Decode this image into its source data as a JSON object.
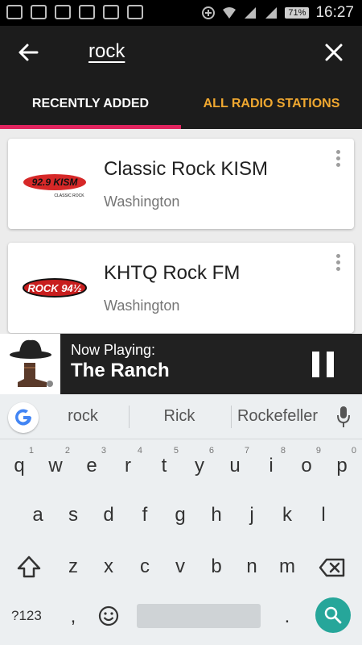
{
  "status_bar": {
    "time": "16:27",
    "battery": "71%"
  },
  "toolbar": {
    "query": "rock"
  },
  "tabs": [
    {
      "label": "RECENTLY ADDED"
    },
    {
      "label": "ALL RADIO STATIONS"
    }
  ],
  "stations": [
    {
      "name": "Classic Rock KISM",
      "location": "Washington",
      "logo_text": "92.9 KISM",
      "logo_sub": "CLASSIC ROCK"
    },
    {
      "name": "KHTQ Rock FM",
      "location": "Washington",
      "logo_text": "ROCK 94½"
    }
  ],
  "now_playing": {
    "label": "Now Playing:",
    "title": "The Ranch"
  },
  "keyboard": {
    "suggestions": [
      "rock",
      "Rick",
      "Rockefeller"
    ],
    "row1": [
      {
        "key": "q",
        "hint": "1"
      },
      {
        "key": "w",
        "hint": "2"
      },
      {
        "key": "e",
        "hint": "3"
      },
      {
        "key": "r",
        "hint": "4"
      },
      {
        "key": "t",
        "hint": "5"
      },
      {
        "key": "y",
        "hint": "6"
      },
      {
        "key": "u",
        "hint": "7"
      },
      {
        "key": "i",
        "hint": "8"
      },
      {
        "key": "o",
        "hint": "9"
      },
      {
        "key": "p",
        "hint": "0"
      }
    ],
    "row2": [
      "a",
      "s",
      "d",
      "f",
      "g",
      "h",
      "j",
      "k",
      "l"
    ],
    "row3": [
      "z",
      "x",
      "c",
      "v",
      "b",
      "n",
      "m"
    ],
    "symbols_label": "?123",
    "comma": ",",
    "period": "."
  },
  "colors": {
    "accent_tab": "#f0a830",
    "indicator": "#e0245e",
    "search_key": "#26a69a"
  }
}
